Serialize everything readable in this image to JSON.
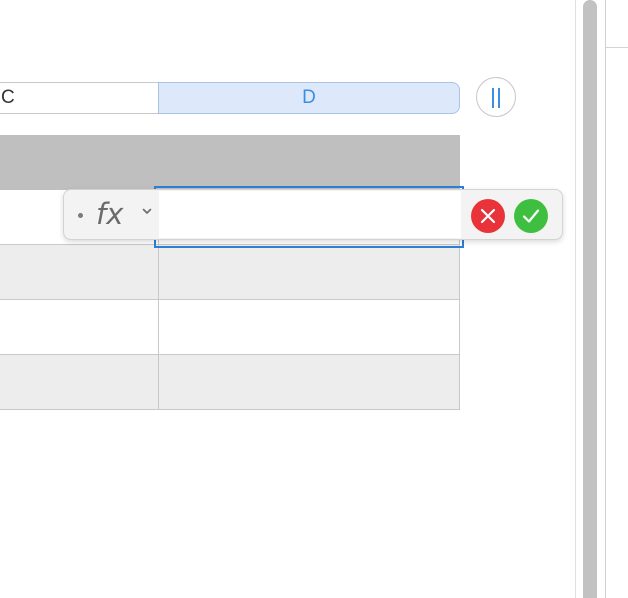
{
  "columns": {
    "c_label": "C",
    "d_label": "D"
  },
  "formula_bar": {
    "fx_label": "fx",
    "input_value": "",
    "icons": {
      "dot": "bullet-icon",
      "chevron": "chevron-down-icon",
      "cancel": "close-icon",
      "accept": "checkmark-icon"
    },
    "cancel_color": "#e8333a",
    "accept_color": "#3fbf3f"
  },
  "toolbar": {
    "pause_icon": "pause-icon"
  },
  "colors": {
    "selected_column": "#dde9fa",
    "accent": "#3d8ee0",
    "header_row": "#bfbfbf",
    "alt_row": "#ededed"
  }
}
